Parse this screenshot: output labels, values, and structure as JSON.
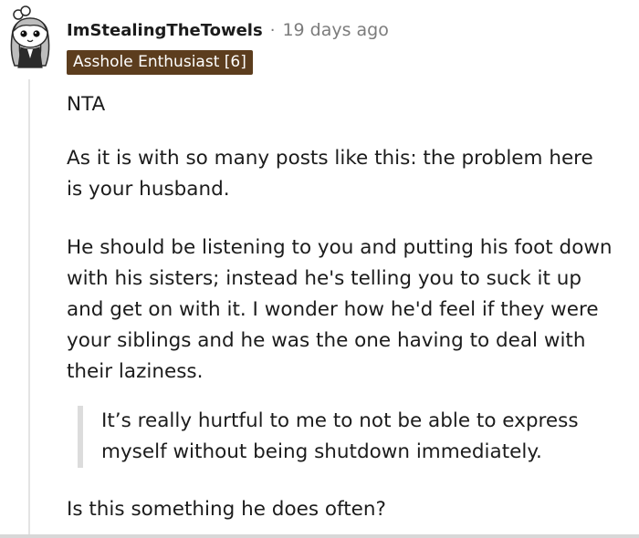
{
  "comment": {
    "username": "ImStealingTheTowels",
    "separator": "·",
    "timestamp": "19 days ago",
    "flair": "Asshole Enthusiast [6]",
    "flair_color": "#5c3d1e",
    "paragraphs": [
      "NTA",
      "As it is with so many posts like this: the problem here is your husband.",
      "He should be listening to you and putting his foot down with his sisters; instead he's telling you to suck it up and get on with it. I wonder how he'd feel if they were your siblings and he was the one having to deal with their laziness."
    ],
    "quote": "It’s really hurtful to me to not be able to express myself without being shutdown immediately.",
    "closing": "Is this something he does often?"
  },
  "avatar": {
    "icon": "snoo-avatar-icon"
  }
}
